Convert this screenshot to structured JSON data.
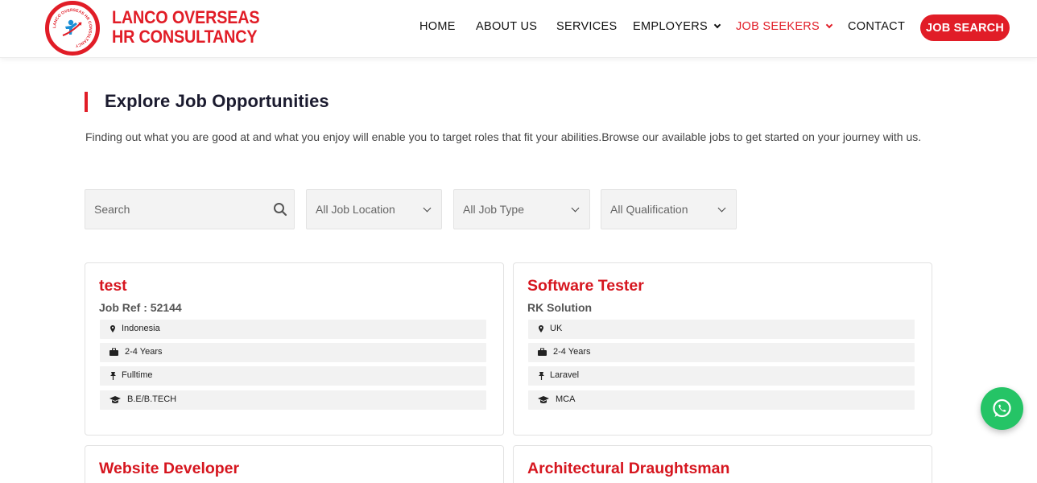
{
  "brand": {
    "line1": "LANCO OVERSEAS",
    "line2": "HR CONSULTANCY",
    "emblem_ring_text": "LANCO OVERSEAS HR CONSULTANCY",
    "color": "#e11d27"
  },
  "nav": {
    "items": [
      {
        "label": "HOME",
        "dropdown": false,
        "active": false
      },
      {
        "label": "ABOUT US",
        "dropdown": false,
        "active": false
      },
      {
        "label": "SERVICES",
        "dropdown": false,
        "active": false
      },
      {
        "label": "EMPLOYERS",
        "dropdown": true,
        "active": false
      },
      {
        "label": "JOB SEEKERS",
        "dropdown": true,
        "active": true
      },
      {
        "label": "CONTACT",
        "dropdown": false,
        "active": false
      }
    ],
    "cta": "JOB SEARCH"
  },
  "section": {
    "title": "Explore Job Opportunities",
    "intro": "Finding out what you are good at and what you enjoy will enable you to target roles that fit your abilities.Browse our available jobs to get started on your journey with us."
  },
  "filters": {
    "search_placeholder": "Search",
    "location": "All Job Location",
    "job_type": "All Job Type",
    "qualification": "All Qualification"
  },
  "jobs": [
    {
      "title": "test",
      "subtitle": "Job Ref : 52144",
      "location": "Indonesia",
      "experience": "2-4 Years",
      "type": "Fulltime",
      "qualification": "B.E/B.TECH"
    },
    {
      "title": "Software Tester",
      "subtitle": "RK Solution",
      "location": "UK",
      "experience": "2-4 Years",
      "type": "Laravel",
      "qualification": "MCA"
    },
    {
      "title": "Website Developer"
    },
    {
      "title": "Architectural Draughtsman"
    }
  ],
  "icons": {
    "location": "map-pin-icon",
    "experience": "briefcase-icon",
    "type": "pushpin-icon",
    "qualification": "graduation-cap-icon",
    "chat": "whatsapp-icon"
  },
  "colors": {
    "accent": "#e11d27",
    "whatsapp": "#25c466"
  }
}
